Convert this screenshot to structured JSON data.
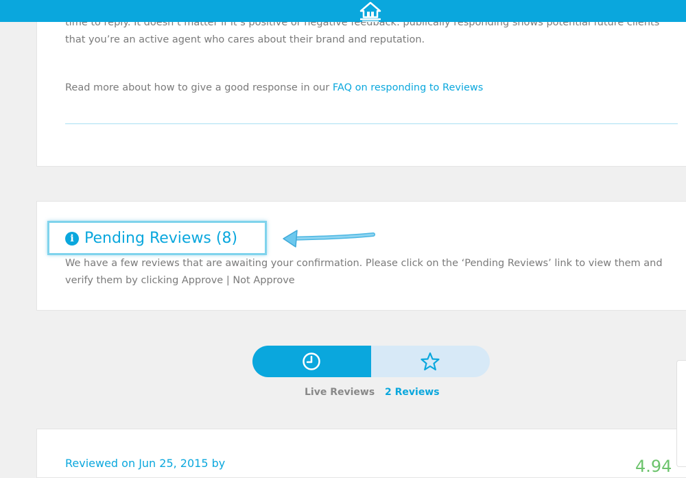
{
  "header": {
    "logo_icon": "house-icon",
    "color": "#0aa7dd"
  },
  "intro": {
    "line1": "time to reply. It doesn’t matter if it’s positive or negative feedback: publically responding shows potential future clients",
    "line2": "that you’re an active agent who cares about their brand and reputation.",
    "read_more_prefix": "Read more about how to give a good response in our ",
    "read_more_link": "FAQ on responding to Reviews"
  },
  "pending": {
    "icon": "info-icon",
    "title": "Pending Reviews (8)",
    "desc_line1": "We have a few reviews that are awaiting your confirmation. Please click on the ‘Pending Reviews’ link to view them and",
    "desc_line2": "verify them by clicking Approve | Not Approve"
  },
  "toggle": {
    "left_icon": "clock-icon",
    "right_icon": "star-icon",
    "live_label": "Live Reviews",
    "reviews_label": "2 Reviews"
  },
  "review": {
    "reviewed_on": "Reviewed on Jun 25, 2015 by",
    "rating": "4.94"
  }
}
